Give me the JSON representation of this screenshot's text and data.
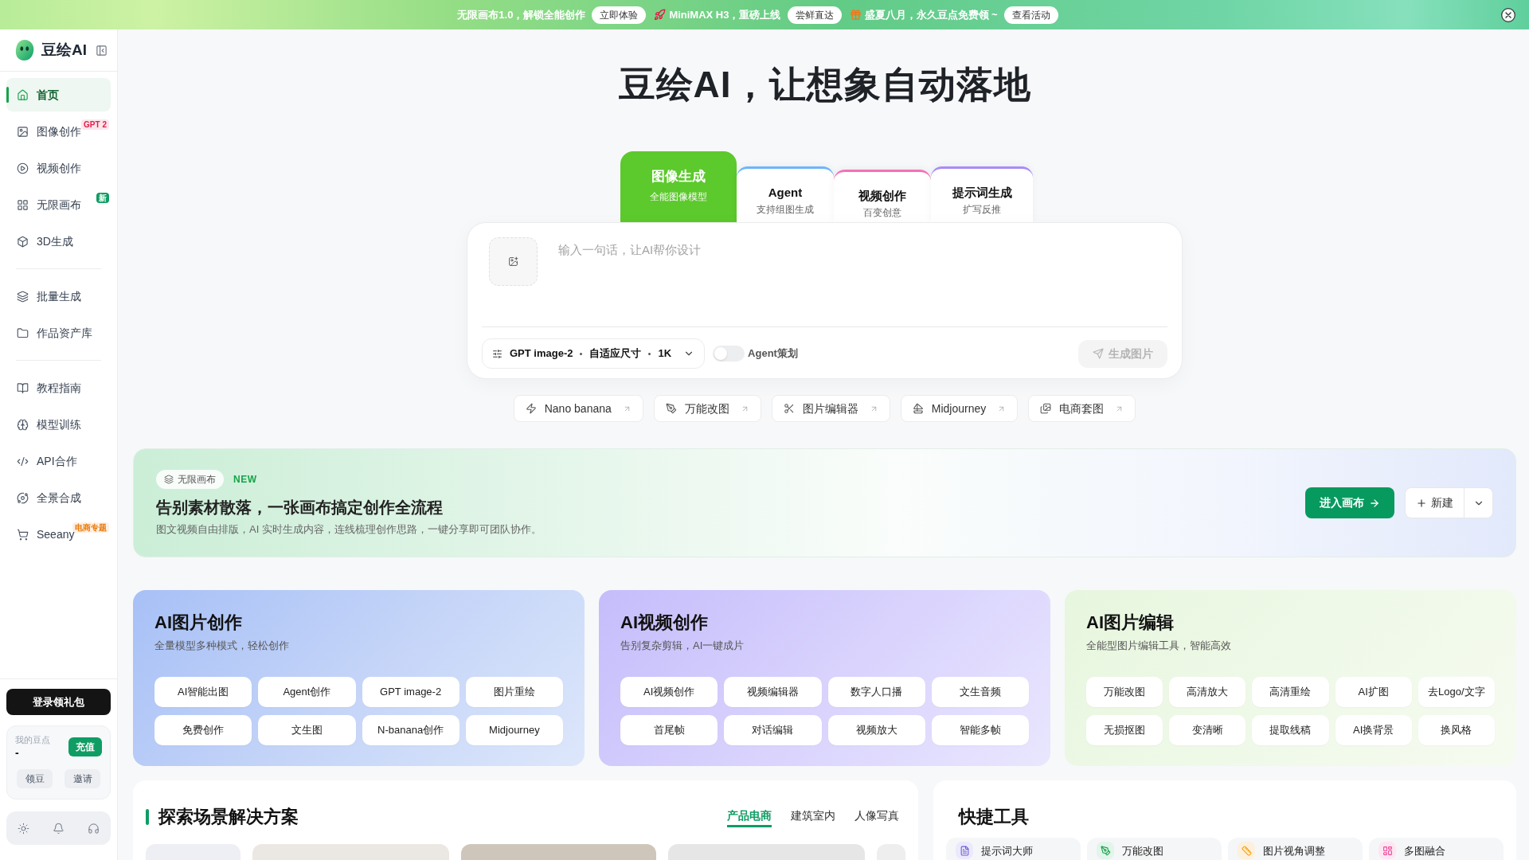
{
  "top_banner": {
    "promos": [
      {
        "text": "无限画布1.0，解锁全能创作",
        "button": "立即体验"
      },
      {
        "text": "MiniMAX H3，重磅上线",
        "button": "尝鲜直达"
      },
      {
        "text": "盛夏八月，永久豆点免费领 ~",
        "button": "查看活动"
      }
    ]
  },
  "sidebar": {
    "logo": "豆绘AI",
    "groups": [
      {
        "items": [
          {
            "label": "首页",
            "selected": true
          },
          {
            "label": "图像创作",
            "selected": false,
            "badge": {
              "text": "GPT 2",
              "kind": "soft",
              "color": "#e11d48"
            }
          },
          {
            "label": "视频创作",
            "selected": false
          },
          {
            "label": "无限画布",
            "selected": false,
            "badge": {
              "text": "新",
              "kind": "solid",
              "color": "#0f9d63"
            }
          },
          {
            "label": "3D生成",
            "selected": false
          }
        ]
      },
      {
        "items": [
          {
            "label": "批量生成",
            "selected": false
          },
          {
            "label": "作品资产库",
            "selected": false
          }
        ]
      },
      {
        "items": [
          {
            "label": "教程指南",
            "selected": false
          },
          {
            "label": "模型训练",
            "selected": false
          },
          {
            "label": "API合作",
            "selected": false
          },
          {
            "label": "全景合成",
            "selected": false
          },
          {
            "label": "Seeany",
            "selected": false,
            "badge": {
              "text": "电商专题",
              "kind": "soft",
              "color": "#ea7a0b"
            }
          }
        ]
      }
    ],
    "login_button": "登录领礼包",
    "points": {
      "label": "我的豆点",
      "value": "-",
      "recharge_button": "充值",
      "actions": [
        "领豆",
        "邀请"
      ]
    }
  },
  "hero": {
    "title": "豆绘AI，让想象自动落地",
    "mode_tabs": [
      {
        "title": "图像生成",
        "subtitle": "全能图像模型",
        "selected": true,
        "color": "#5cc92c"
      },
      {
        "title": "Agent",
        "subtitle": "支持组图生成",
        "selected": false,
        "color": "#6cb4fb"
      },
      {
        "title": "视频创作",
        "subtitle": "百变创意",
        "selected": false,
        "color": "#f472b6"
      },
      {
        "title": "提示词生成",
        "subtitle": "扩写反推",
        "selected": false,
        "color": "#a78bfa"
      }
    ],
    "prompt": {
      "placeholder": "输入一句话，让AI帮你设计",
      "model": "GPT image-2",
      "size": "自适应尺寸",
      "resolution": "1K",
      "agent_toggle": {
        "label": "Agent策划",
        "on": false
      },
      "generate_button": {
        "label": "生成图片",
        "disabled": true
      }
    },
    "quick_links": [
      "Nano banana",
      "万能改图",
      "图片编辑器",
      "Midjourney",
      "电商套图"
    ]
  },
  "canvas_banner": {
    "tag": "无限画布",
    "new_label": "NEW",
    "title": "告别素材散落，一张画布搞定创作全流程",
    "description": "图文视频自由排版，AI 实时生成内容，连线梳理创作思路，一键分享即可团队协作。",
    "enter_button": "进入画布",
    "new_button": "新建"
  },
  "feature_cards": [
    {
      "title": "AI图片创作",
      "subtitle": "全量模型多种模式，轻松创作",
      "buttons": [
        "AI智能出图",
        "Agent创作",
        "GPT image-2",
        "图片重绘",
        "免费创作",
        "文生图",
        "N-banana创作",
        "Midjourney"
      ]
    },
    {
      "title": "AI视频创作",
      "subtitle": "告别复杂剪辑，AI一键成片",
      "buttons": [
        "AI视频创作",
        "视频编辑器",
        "数字人口播",
        "文生音频",
        "首尾帧",
        "对话编辑",
        "视频放大",
        "智能多帧"
      ]
    },
    {
      "title": "AI图片编辑",
      "subtitle": "全能型图片编辑工具，智能高效",
      "buttons": [
        "万能改图",
        "高清放大",
        "高清重绘",
        "AI扩图",
        "去Logo/文字",
        "无损抠图",
        "变清晰",
        "提取线稿",
        "AI换背景",
        "换风格"
      ]
    }
  ],
  "scenes": {
    "title": "探索场景解决方案",
    "tabs": [
      {
        "label": "产品电商",
        "selected": true
      },
      {
        "label": "建筑室内",
        "selected": false
      },
      {
        "label": "人像写真",
        "selected": false
      }
    ]
  },
  "quick_tools": {
    "title": "快捷工具",
    "items": [
      "提示词大师",
      "万能改图",
      "图片视角调整",
      "多图融合"
    ]
  }
}
